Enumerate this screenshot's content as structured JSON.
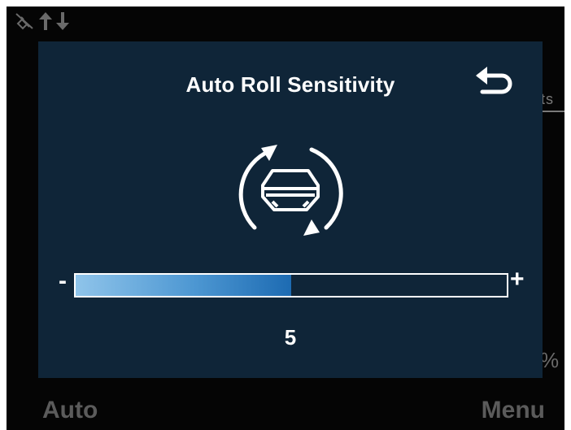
{
  "dialog": {
    "title": "Auto Roll Sensitivity",
    "icon": "boat-roll-icon",
    "back_icon": "back-arrow-icon"
  },
  "slider": {
    "min_label": "-",
    "max_label": "+",
    "value": 5,
    "min": 0,
    "max": 10,
    "fill_color": "#1d6bb2"
  },
  "background": {
    "partial_text": "ts",
    "partial_percent": "%",
    "status_icons": [
      "satellite-off-icon",
      "up-down-arrows-icon"
    ]
  },
  "softkeys": {
    "left": "Auto",
    "right": "Menu"
  },
  "colors": {
    "dialog_bg": "#0f2538",
    "screen_bg": "#050505",
    "text": "#ffffff"
  }
}
